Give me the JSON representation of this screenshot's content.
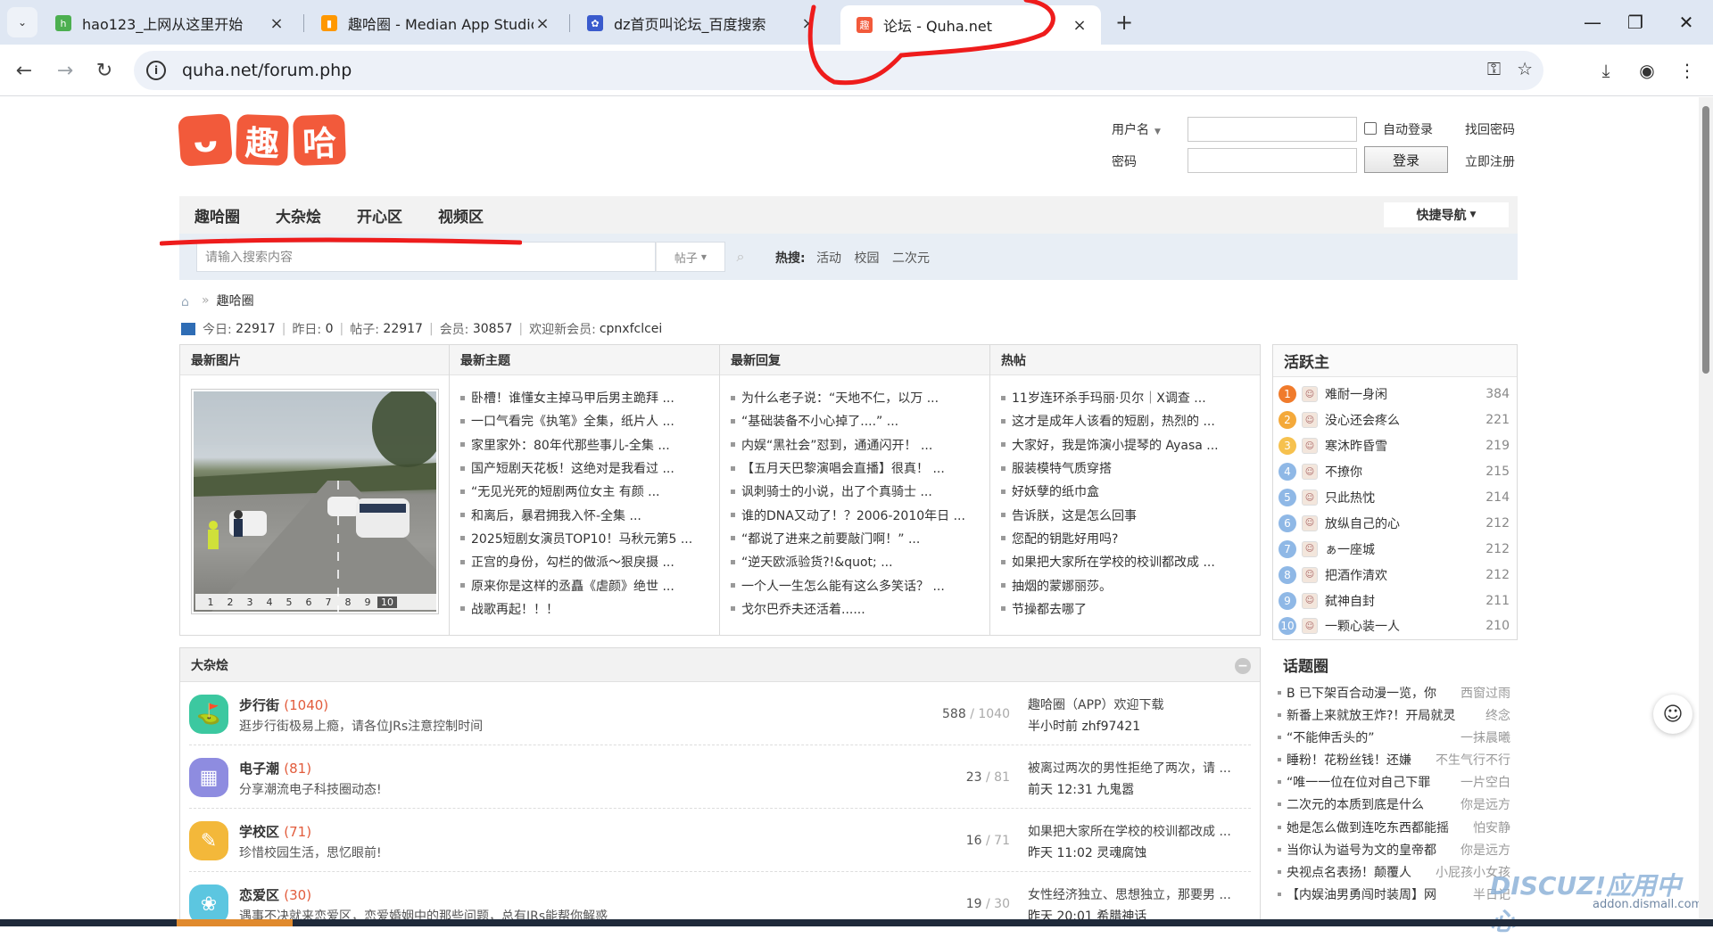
{
  "browser": {
    "tabs": [
      {
        "title": "hao123_上网从这里开始",
        "icon": "hao123-icon",
        "color": "#4caf50"
      },
      {
        "title": "趣哈圈 - Median App Studio",
        "icon": "median-icon",
        "color": "#ff9800"
      },
      {
        "title": "dz首页叫论坛_百度搜索",
        "icon": "baidu-paw-icon",
        "color": "#3a5bcd"
      },
      {
        "title": "论坛 - Quha.net",
        "icon": "quha-icon",
        "color": "#f25a3b"
      }
    ],
    "url": "quha.net/forum.php"
  },
  "header": {
    "logo_chars": [
      "ᴗ",
      "趣",
      "哈"
    ],
    "login": {
      "username_label": "用户名",
      "password_label": "密码",
      "auto_login": "自动登录",
      "login_button": "登录",
      "forgot": "找回密码",
      "register": "立即注册"
    }
  },
  "nav": {
    "items": [
      "趣哈圈",
      "大杂烩",
      "开心区",
      "视频区"
    ],
    "quick_nav": "快捷导航"
  },
  "search": {
    "placeholder": "请输入搜索内容",
    "type": "帖子",
    "hot_label": "热搜:",
    "hot_keywords": [
      "活动",
      "校园",
      "二次元"
    ]
  },
  "breadcrumb": {
    "current": "趣哈圈",
    "separator": "»"
  },
  "stats": {
    "today_label": "今日:",
    "today": "22917",
    "yesterday_label": "昨日:",
    "yesterday": "0",
    "posts_label": "帖子:",
    "posts": "22917",
    "members_label": "会员:",
    "members": "30857",
    "newest_label": "欢迎新会员:",
    "newest": "cpnxfclcei"
  },
  "columns": {
    "photos": {
      "title": "最新图片",
      "pages": [
        "1",
        "2",
        "3",
        "4",
        "5",
        "6",
        "7",
        "8",
        "9",
        "10"
      ]
    },
    "new_topics": {
      "title": "最新主题",
      "items": [
        "卧槽！谁懂女主掉马甲后男主跪拜 ...",
        "一口气看完《执笔》全集，纸片人 ...",
        "家里家外：80年代那些事儿-全集 ...",
        "国产短剧天花板！这绝对是我看过 ...",
        "“无见光死的短剧两位女主 有颜 ...",
        "和离后，暴君拥我入怀-全集 ...",
        "2025短剧女演员TOP10！马秋元第5 ...",
        "正宫的身份，勾栏的做派～狠戾摄 ...",
        "原来你是这样的丞矗《虐颜》绝世 ...",
        "战歌再起！！！"
      ]
    },
    "new_replies": {
      "title": "最新回复",
      "items": [
        "为什么老子说：“天地不仁，以万 ...",
        "“基础装备不小心掉了....” ...",
        "内娱“黑社会”怼到，通通闪开！ ...",
        "【五月天巴黎演唱会直播】很真！ ...",
        "讽刺骑士的小说，出了个真骑士 ...",
        "谁的DNA又动了！？2006-2010年日 ...",
        "“都说了进来之前要敲门啊！” ...",
        "“逆天欧派验货?!&quot; ...",
        "一个人一生怎么能有这么多笑话？ ...",
        "戈尔巴乔夫还活着......"
      ]
    },
    "hot": {
      "title": "热帖",
      "items": [
        "11岁连环杀手玛丽·贝尔｜X调查 ...",
        "这才是成年人该看的短剧，热烈的 ...",
        "大家好，我是饰演小提琴的 Ayasa ...",
        "服装模特气质穿搭",
        "好妖孽的纸巾盒",
        "告诉朕，这是怎么回事",
        "您配的钥匙好用吗?",
        "如果把大家所在学校的校训都改成 ...",
        "抽烟的蒙娜丽莎。",
        "节操都去哪了"
      ]
    }
  },
  "section": {
    "title": "大杂烩",
    "forums": [
      {
        "name": "步行街",
        "count": "(1040)",
        "desc": "逛步行街极易上瘾，请各位JRs注意控制时间",
        "threads": "588",
        "posts": "1040",
        "last_title": "趣哈圈（APP）欢迎下载",
        "last_meta": "半小时前 zhf97421",
        "icon": "walking-street-icon",
        "color": "#3cc8a0",
        "glyph": "⛳"
      },
      {
        "name": "电子潮",
        "count": "(81)",
        "desc": "分享潮流电子科技圈动态!",
        "threads": "23",
        "posts": "81",
        "last_title": "被离过两次的男性拒绝了两次，请 ...",
        "last_meta": "前天 12:31 九鬼嚣",
        "icon": "electronics-icon",
        "color": "#8e8ce0",
        "glyph": "▦"
      },
      {
        "name": "学校区",
        "count": "(71)",
        "desc": "珍惜校园生活，思忆眼前!",
        "threads": "16",
        "posts": "71",
        "last_title": "如果把大家所在学校的校训都改成 ...",
        "last_meta": "昨天 11:02 灵魂腐蚀",
        "icon": "school-icon",
        "color": "#f3b83a",
        "glyph": "✎"
      },
      {
        "name": "恋爱区",
        "count": "(30)",
        "desc": "遇事不决就来恋爱区，恋爱婚姻中的那些问题，总有JRs能帮你解惑",
        "threads": "19",
        "posts": "30",
        "last_title": "女性经济独立、思想独立，那要男 ...",
        "last_meta": "昨天 20:01 希腊神话",
        "icon": "love-icon",
        "color": "#5cc6e0",
        "glyph": "❀"
      }
    ]
  },
  "sidebar": {
    "active_title": "活跃主",
    "active_users": [
      {
        "rank": "1",
        "name": "难耐一身闲",
        "score": "384",
        "color": "#f07b2c"
      },
      {
        "rank": "2",
        "name": "没心还会疼么",
        "score": "221",
        "color": "#f4a93a"
      },
      {
        "rank": "3",
        "name": "寒沐昨昏雪",
        "score": "219",
        "color": "#f6c14e"
      },
      {
        "rank": "4",
        "name": "不撩你",
        "score": "215",
        "color": "#8fb8e6"
      },
      {
        "rank": "5",
        "name": "只此热忱",
        "score": "214",
        "color": "#8fb8e6"
      },
      {
        "rank": "6",
        "name": "放纵自己的心",
        "score": "212",
        "color": "#8fb8e6"
      },
      {
        "rank": "7",
        "name": "ぁ一座城",
        "score": "212",
        "color": "#8fb8e6"
      },
      {
        "rank": "8",
        "name": "把酒作清欢",
        "score": "212",
        "color": "#8fb8e6"
      },
      {
        "rank": "9",
        "name": "弑神自封",
        "score": "211",
        "color": "#8fb8e6"
      },
      {
        "rank": "10",
        "name": "一颗心装一人",
        "score": "210",
        "color": "#8fb8e6"
      }
    ],
    "topic_title": "话题圈",
    "topics": [
      {
        "text": "B 已下架百合动漫一览，你",
        "who": "西窗过雨"
      },
      {
        "text": "新番上来就放王炸?！开局就灵",
        "who": "终念"
      },
      {
        "text": "“不能伸舌头的”",
        "who": "一抹晨曦"
      },
      {
        "text": "睡粉！花粉丝钱！还嫌",
        "who": "不生气行不行"
      },
      {
        "text": "“唯一一位在位对自己下罪",
        "who": "一片空白"
      },
      {
        "text": "二次元的本质到底是什么",
        "who": "你是远方"
      },
      {
        "text": "她是怎么做到连吃东西都能摇",
        "who": "怕安静"
      },
      {
        "text": "当你认为谥号为文的皇帝都",
        "who": "你是远方"
      },
      {
        "text": "央视点名表扬！颠覆人",
        "who": "小屁孩小女孩"
      },
      {
        "text": "【内娱油男勇闯时装周】网",
        "who": "半日记"
      }
    ]
  },
  "watermark": {
    "brand": "DISCUZ!",
    "sub_brand": "应用中心",
    "site": "addon.dismall.com"
  }
}
